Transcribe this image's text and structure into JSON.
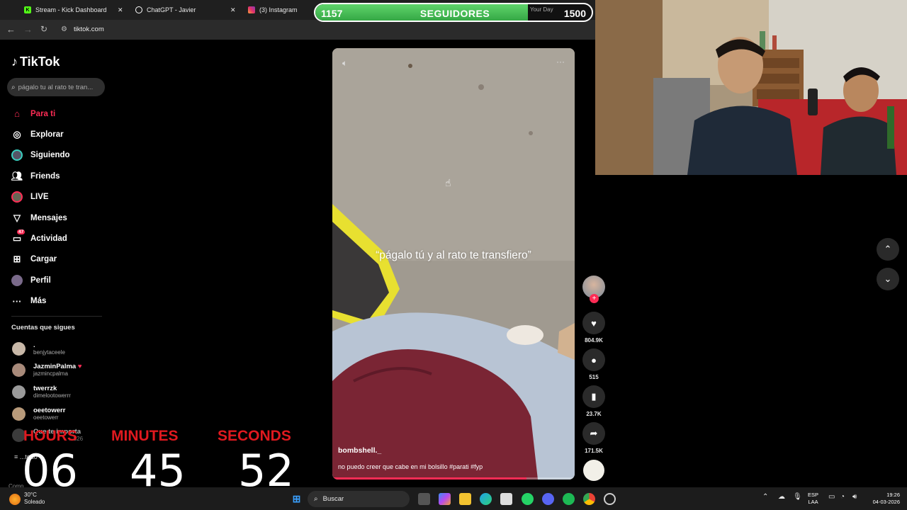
{
  "browser": {
    "tabs": [
      {
        "label": "Stream - Kick Dashboard",
        "icon": "kick-icon",
        "color": "#53fc18"
      },
      {
        "label": "ChatGPT - Javier",
        "icon": "chatgpt-icon",
        "color": "#ffffff"
      },
      {
        "label": "(3) Instagram",
        "icon": "instagram-icon",
        "color": "#e1306c"
      }
    ],
    "url": "tiktok.com"
  },
  "followers_overlay": {
    "current": "1157",
    "label": "SEGUIDORES",
    "goal": "1500",
    "behind_text": "Your Day",
    "progress": 0.77,
    "color": "#3fbf4f"
  },
  "tiktok": {
    "logo": "TikTok",
    "search_placeholder": "págalo tu al rato te tran...",
    "nav": [
      {
        "label": "Para ti",
        "icon": "home-icon",
        "active": true
      },
      {
        "label": "Explorar",
        "icon": "compass-icon"
      },
      {
        "label": "Siguiendo",
        "icon": "following-avatar-icon"
      },
      {
        "label": "Friends",
        "icon": "friends-icon"
      },
      {
        "label": "LIVE",
        "icon": "live-icon"
      },
      {
        "label": "Mensajes",
        "icon": "send-icon"
      },
      {
        "label": "Actividad",
        "icon": "inbox-icon",
        "badge": "47"
      },
      {
        "label": "Cargar",
        "icon": "upload-icon"
      },
      {
        "label": "Perfil",
        "icon": "profile-avatar-icon"
      },
      {
        "label": "Más",
        "icon": "more-icon"
      }
    ],
    "following_header": "Cuentas que sigues",
    "accounts": [
      {
        "name": ".",
        "handle": "benjytaceele"
      },
      {
        "name": "JazminPalma",
        "handle": "jazmincpalma",
        "heart": "♥"
      },
      {
        "name": "twerrzk",
        "handle": "dimelootowerrr"
      },
      {
        "name": "oeetowerr",
        "handle": "oeetowerr"
      },
      {
        "name": "Que te importa",
        "handle": "...826"
      }
    ],
    "see_all": "...todo",
    "footer_partial": "Comp..."
  },
  "countdown": {
    "hours_label": "HOURS",
    "minutes_label": "MINUTES",
    "seconds_label": "SECONDS",
    "hours": "06",
    "minutes": "45",
    "seconds": "52"
  },
  "video": {
    "caption": "“págalo tú y al rato te transfiero”",
    "username": "bombshell._",
    "description": "no puedo creer que cabe en mi bolsillo #parati #fyp",
    "progress": 0.8,
    "likes": "804.9K",
    "comments": "515",
    "saves": "23.7K",
    "shares": "171.5K"
  },
  "taskbar": {
    "temperature": "30°C",
    "weather": "Soleado",
    "search_label": "Buscar",
    "lang_line1": "ESP",
    "lang_line2": "LAA",
    "time": "19:26",
    "date": "04-03-2026"
  }
}
